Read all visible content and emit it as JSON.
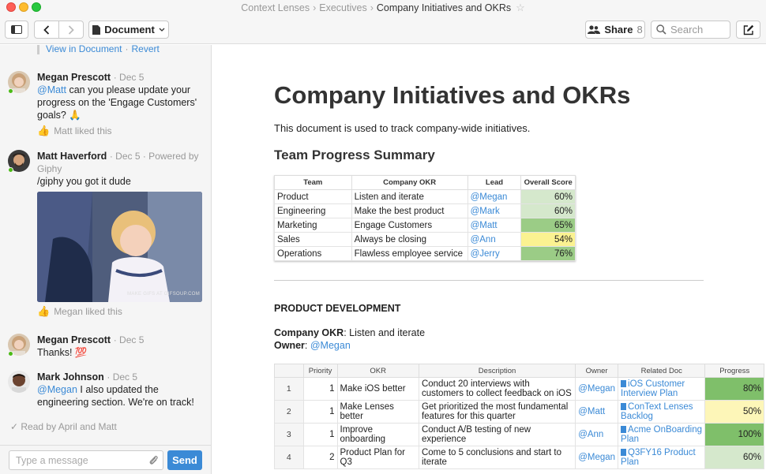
{
  "window": {
    "breadcrumbs": [
      "Context Lenses",
      "Executives"
    ],
    "current": "Company Initiatives and OKRs"
  },
  "toolbar": {
    "doc_label": "Document",
    "share_label": "Share",
    "share_count": "8",
    "search_placeholder": "Search"
  },
  "sidebar": {
    "view_in_doc": "View in Document",
    "revert": "Revert",
    "messages": [
      {
        "author": "Megan Prescott",
        "meta": "· Dec 5",
        "mention": "@Matt",
        "text": " can you please update your progress on the 'Engage Customers' goals? 🙏",
        "likes": "Matt liked this"
      },
      {
        "author": "Matt Haverford",
        "meta": "· Dec 5 · Powered by Giphy",
        "text": "/giphy you got it dude",
        "gif_watermark": "MAKE GIFS AT GIFSOUP.COM",
        "likes": "Megan liked this"
      },
      {
        "author": "Megan Prescott",
        "meta": "· Dec 5",
        "text": "Thanks! 💯"
      },
      {
        "author": "Mark Johnson",
        "meta": "· Dec 5",
        "mention": "@Megan",
        "text": " I also updated the engineering section. We're on track!"
      }
    ],
    "read_by": "✓ Read by April and Matt",
    "composer": {
      "placeholder": "Type a message",
      "send": "Send"
    }
  },
  "doc": {
    "title": "Company Initiatives and OKRs",
    "intro": "This document is used to track company-wide initiatives.",
    "summary_heading": "Team Progress Summary",
    "summary_table": {
      "headers": [
        "Team",
        "Company OKR",
        "Lead",
        "Overall Score"
      ],
      "rows": [
        {
          "team": "Product",
          "okr": "Listen and iterate",
          "lead": "@Megan",
          "score": "60%",
          "color": "#d5e8cc"
        },
        {
          "team": "Engineering",
          "okr": "Make the best product",
          "lead": "@Mark",
          "score": "60%",
          "color": "#d5e8cc"
        },
        {
          "team": "Marketing",
          "okr": "Engage Customers",
          "lead": "@Matt",
          "score": "65%",
          "color": "#9bcc86"
        },
        {
          "team": "Sales",
          "okr": "Always be closing",
          "lead": "@Ann",
          "score": "54%",
          "color": "#fbf291"
        },
        {
          "team": "Operations",
          "okr": "Flawless employee service",
          "lead": "@Jerry",
          "score": "76%",
          "color": "#9bcc86"
        }
      ]
    },
    "section_title": "PRODUCT DEVELOPMENT",
    "company_okr_label": "Company OKR",
    "company_okr_value": ": Listen and iterate",
    "owner_label": "Owner",
    "owner_value": "@Megan",
    "okr_table": {
      "headers": [
        "",
        "Priority",
        "OKR",
        "Description",
        "Owner",
        "Related Doc",
        "Progress"
      ],
      "rows": [
        {
          "n": "1",
          "priority": "1",
          "okr": "Make iOS better",
          "desc": "Conduct 20 interviews with customers to collect feedback on iOS",
          "owner": "@Megan",
          "doc": "iOS Customer Interview Plan",
          "progress": "80%",
          "color": "#7fbf6a"
        },
        {
          "n": "2",
          "priority": "1",
          "okr": "Make Lenses better",
          "desc": "Get prioritized the most fundamental features for this quarter",
          "owner": "@Matt",
          "doc": "ConText Lenses Backlog",
          "progress": "50%",
          "color": "#fdf6b8"
        },
        {
          "n": "3",
          "priority": "1",
          "okr": "Improve onboarding",
          "desc": "Conduct A/B testing of new experience",
          "owner": "@Ann",
          "doc": "Acme OnBoarding Plan",
          "progress": "100%",
          "color": "#7fbf6a"
        },
        {
          "n": "4",
          "priority": "2",
          "okr": "Product Plan for Q3",
          "desc": "Come to 5 conclusions and start to iterate",
          "owner": "@Megan",
          "doc": "Q3FY16 Product Plan",
          "progress": "60%",
          "color": "#d5e8cc"
        }
      ]
    }
  }
}
